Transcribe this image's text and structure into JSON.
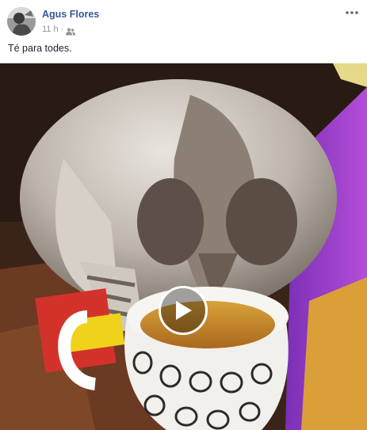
{
  "post": {
    "author": {
      "name": "Agus Flores"
    },
    "timestamp": "11 h",
    "audience_icon": "friends-icon",
    "more_icon": "more-options-icon",
    "text": "Té para todes.",
    "media": {
      "type": "video",
      "play_icon": "play-icon"
    }
  },
  "colors": {
    "author_link": "#385898",
    "meta_text": "#90949c",
    "body_text": "#1d2129"
  }
}
